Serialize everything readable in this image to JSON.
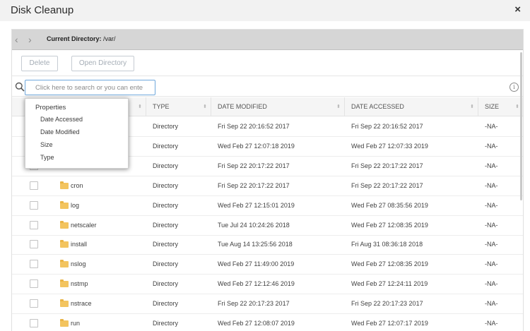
{
  "window": {
    "title": "Disk Cleanup",
    "close_symbol": "×"
  },
  "nav": {
    "back_symbol": "‹",
    "forward_symbol": "›",
    "current_dir_label": "Current Directory:",
    "current_dir_value": " /var/"
  },
  "toolbar": {
    "delete_label": "Delete",
    "open_label": "Open Directory"
  },
  "search": {
    "placeholder": "Click here to search or you can ente"
  },
  "table": {
    "headers": {
      "name": "",
      "type": "TYPE",
      "modified": "DATE MODIFIED",
      "accessed": "DATE ACCESSED",
      "size": "SIZE"
    },
    "sort_symbol": "⬍",
    "rows": [
      {
        "name": "",
        "type": "Directory",
        "modified": "Fri Sep 22 20:16:52 2017",
        "accessed": "Fri Sep 22 20:16:52 2017",
        "size": "-NA-"
      },
      {
        "name": "",
        "type": "Directory",
        "modified": "Wed Feb 27 12:07:18 2019",
        "accessed": "Wed Feb 27 12:07:33 2019",
        "size": "-NA-"
      },
      {
        "name": "",
        "type": "Directory",
        "modified": "Fri Sep 22 20:17:22 2017",
        "accessed": "Fri Sep 22 20:17:22 2017",
        "size": "-NA-"
      },
      {
        "name": "cron",
        "type": "Directory",
        "modified": "Fri Sep 22 20:17:22 2017",
        "accessed": "Fri Sep 22 20:17:22 2017",
        "size": "-NA-"
      },
      {
        "name": "log",
        "type": "Directory",
        "modified": "Wed Feb 27 12:15:01 2019",
        "accessed": "Wed Feb 27 08:35:56 2019",
        "size": "-NA-"
      },
      {
        "name": "netscaler",
        "type": "Directory",
        "modified": "Tue Jul 24 10:24:26 2018",
        "accessed": "Wed Feb 27 12:08:35 2019",
        "size": "-NA-"
      },
      {
        "name": "install",
        "type": "Directory",
        "modified": "Tue Aug 14 13:25:56 2018",
        "accessed": "Fri Aug 31 08:36:18 2018",
        "size": "-NA-"
      },
      {
        "name": "nslog",
        "type": "Directory",
        "modified": "Wed Feb 27 11:49:00 2019",
        "accessed": "Wed Feb 27 12:08:35 2019",
        "size": "-NA-"
      },
      {
        "name": "nstmp",
        "type": "Directory",
        "modified": "Wed Feb 27 12:12:46 2019",
        "accessed": "Wed Feb 27 12:24:11 2019",
        "size": "-NA-"
      },
      {
        "name": "nstrace",
        "type": "Directory",
        "modified": "Fri Sep 22 20:17:23 2017",
        "accessed": "Fri Sep 22 20:17:23 2017",
        "size": "-NA-"
      },
      {
        "name": "run",
        "type": "Directory",
        "modified": "Wed Feb 27 12:08:07 2019",
        "accessed": "Wed Feb 27 12:07:17 2019",
        "size": "-NA-"
      }
    ]
  },
  "properties_menu": {
    "heading": "Properties",
    "items": [
      "Date Accessed",
      "Date Modified",
      "Size",
      "Type"
    ]
  },
  "colors": {
    "title_bar": "#f2f2f2",
    "nav_bar": "#d6d6d6",
    "search_border": "#6fa8dc",
    "folder": "#f3c45f"
  },
  "icons": {
    "close": "close-icon",
    "search": "search-icon",
    "info": "info-icon",
    "folder": "folder-icon",
    "back": "chevron-left-icon",
    "forward": "chevron-right-icon"
  }
}
